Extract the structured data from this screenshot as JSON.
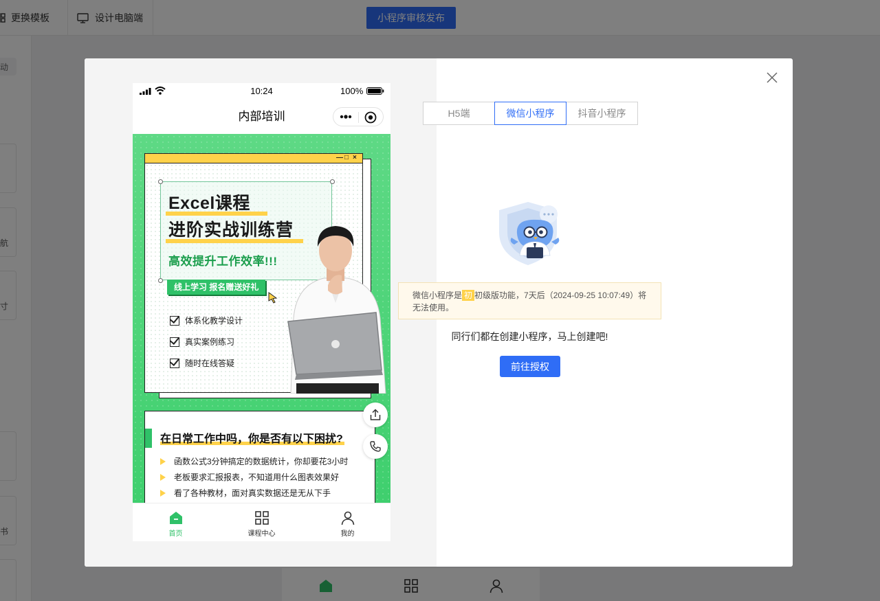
{
  "editor": {
    "change_template": "更换模板",
    "design_pc": "设计电脑端",
    "publish": "小程序审核发布",
    "left_labels": [
      "动",
      "航",
      "寸",
      "书"
    ]
  },
  "phone": {
    "status": {
      "time": "10:24",
      "battery": "100%"
    },
    "nav_title": "内部培训",
    "banner": {
      "title_line1": "Excel课程",
      "title_line2": "进阶实战训练营",
      "subtitle": "高效提升工作效率!!!",
      "cta": "线上学习 报名赠送好礼",
      "checks": [
        "体系化教学设计",
        "真实案例练习",
        "随时在线答疑"
      ],
      "window_controls": [
        "—",
        "□",
        "×"
      ]
    },
    "section": {
      "title": "在日常工作中吗，你是否有以下困扰?",
      "items": [
        "函数公式3分钟搞定的数据统计，你却要花3小时",
        "老板要求汇报报表，不知道用什么图表效果好",
        "看了各种教材，面对真实数据还是无从下手"
      ]
    },
    "tabs": [
      {
        "label": "首页",
        "icon": "home-icon",
        "active": true
      },
      {
        "label": "课程中心",
        "icon": "grid-icon",
        "active": false
      },
      {
        "label": "我的",
        "icon": "user-icon",
        "active": false
      }
    ],
    "float_buttons": [
      "share-icon",
      "phone-icon"
    ]
  },
  "platform_tabs": [
    {
      "label": "H5端",
      "active": false
    },
    {
      "label": "微信小程序",
      "active": true
    },
    {
      "label": "抖音小程序",
      "active": false
    }
  ],
  "notice": {
    "prefix": "微信小程序是",
    "tag": "初",
    "suffix": "初级版功能，7天后（2024-09-25 10:07:49）将无法使用。"
  },
  "promo_text": "同行们都在创建小程序，马上创建吧!",
  "auth_button": "前往授权",
  "colors": {
    "primary": "#2f6df6",
    "green": "#2fc168",
    "yellow": "#ffd24a"
  }
}
